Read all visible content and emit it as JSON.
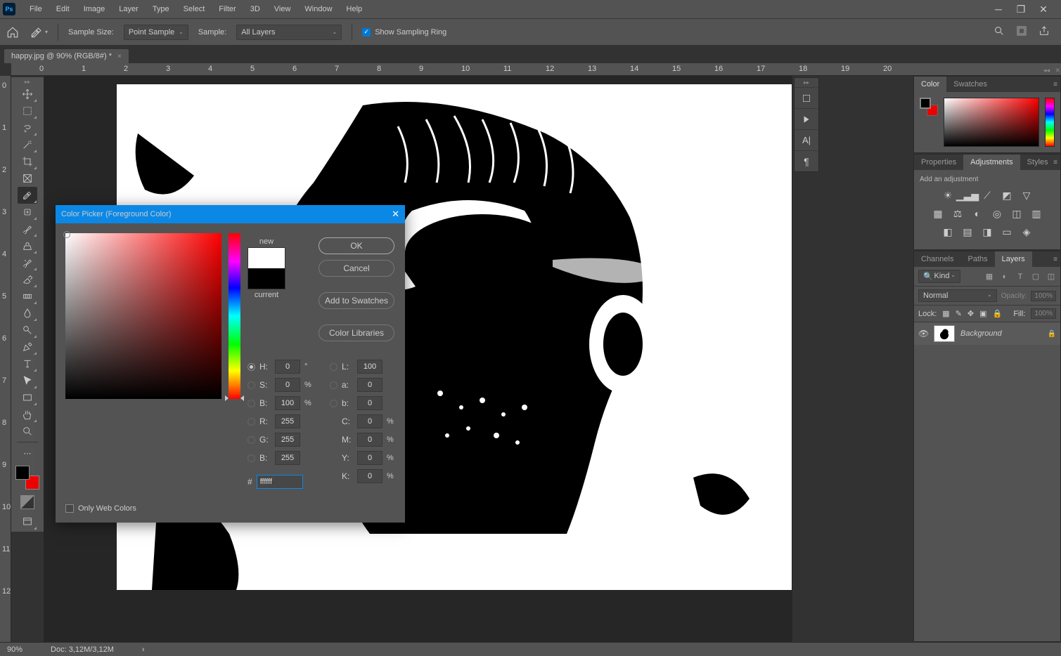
{
  "menu": {
    "items": [
      "File",
      "Edit",
      "Image",
      "Layer",
      "Type",
      "Select",
      "Filter",
      "3D",
      "View",
      "Window",
      "Help"
    ]
  },
  "optbar": {
    "sample_size_label": "Sample Size:",
    "sample_size_value": "Point Sample",
    "sample_label": "Sample:",
    "sample_value": "All Layers",
    "show_ring": "Show Sampling Ring"
  },
  "tab": {
    "title": "happy.jpg @ 90% (RGB/8#) *"
  },
  "ruler_marks": [
    "0",
    "1",
    "2",
    "3",
    "4",
    "5",
    "6",
    "7",
    "8",
    "9",
    "10",
    "11",
    "12",
    "13",
    "14",
    "15",
    "16",
    "17",
    "18",
    "19",
    "20"
  ],
  "ruler_v": [
    "0",
    "1",
    "2",
    "3",
    "4",
    "5",
    "6",
    "7",
    "8",
    "9",
    "10",
    "11",
    "12"
  ],
  "panels": {
    "color": {
      "tab1": "Color",
      "tab2": "Swatches"
    },
    "props": {
      "tab1": "Properties",
      "tab2": "Adjustments",
      "tab3": "Styles",
      "add_label": "Add an adjustment"
    },
    "layers": {
      "tab1": "Channels",
      "tab2": "Paths",
      "tab3": "Layers",
      "kind": "Kind",
      "blend": "Normal",
      "opacity_label": "Opacity:",
      "opacity": "100%",
      "lock_label": "Lock:",
      "fill_label": "Fill:",
      "fill": "100%",
      "layer_name": "Background"
    }
  },
  "dialog": {
    "title": "Color Picker (Foreground Color)",
    "ok": "OK",
    "cancel": "Cancel",
    "add_swatch": "Add to Swatches",
    "libraries": "Color Libraries",
    "new": "new",
    "current": "current",
    "H": "0",
    "S": "0",
    "B": "100",
    "L": "100",
    "a": "0",
    "b": "0",
    "R": "255",
    "G": "255",
    "Bb": "255",
    "C": "0",
    "M": "0",
    "Y": "0",
    "K": "0",
    "hex": "ffffff",
    "web_only": "Only Web Colors"
  },
  "status": {
    "zoom": "90%",
    "doc": "Doc: 3,12M/3,12M"
  }
}
